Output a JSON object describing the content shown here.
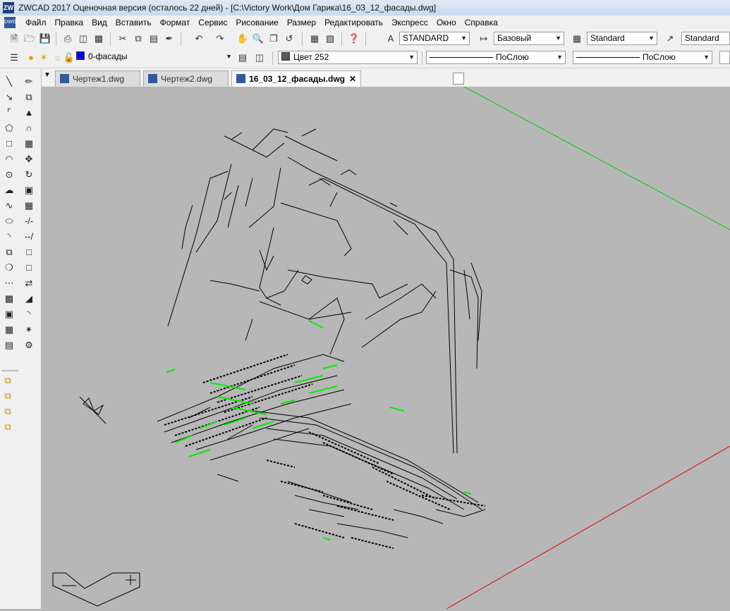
{
  "window": {
    "title": "ZWCAD 2017 Оценочная версия (осталось 22 дней) - [C:\\Victory Work\\Дом Гарика\\16_03_12_фасады.dwg]",
    "app_icon": "zwcad-app-icon"
  },
  "menubar": {
    "doc_icon": "DWG",
    "items": [
      "Файл",
      "Правка",
      "Вид",
      "Вставить",
      "Формат",
      "Сервис",
      "Рисование",
      "Размер",
      "Редактировать",
      "Экспресс",
      "Окно",
      "Справка"
    ]
  },
  "toolbar": {
    "text_style": "STANDARD",
    "dim_style": "Базовый",
    "table_style": "Standard",
    "multileader_style": "Standard"
  },
  "layers_bar": {
    "layer_name": "0-фасады",
    "layer_color": "#0000ff",
    "color_name": "Цвет 252",
    "color_swatch": "#595959",
    "linetype": "ПоСлою",
    "lineweight": "ПоСлою"
  },
  "tabs": [
    {
      "label": "Чертеж1.dwg",
      "active": false
    },
    {
      "label": "Чертеж2.dwg",
      "active": false
    },
    {
      "label": "16_03_12_фасады.dwg",
      "active": true
    }
  ],
  "colors": {
    "canvas": "#b7b7b7",
    "axis_x": "#e00000",
    "axis_y": "#00cc00",
    "geometry": "#000000",
    "highlight_geometry": "#00ee00"
  }
}
